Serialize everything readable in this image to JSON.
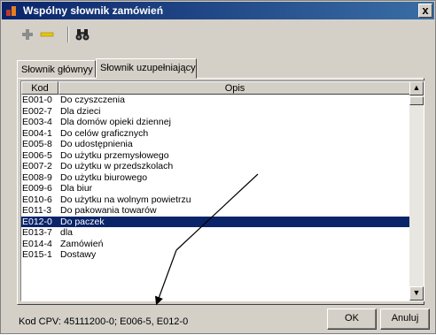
{
  "window": {
    "title": "Wspólny słownik zamówień",
    "close_label": "x"
  },
  "toolbar": {
    "add_icon": "plus-icon",
    "remove_icon": "minus-icon",
    "find_icon": "binoculars-icon"
  },
  "tabs": [
    {
      "label": "Słownik głównyy"
    },
    {
      "label": "Słownik uzupełniający"
    }
  ],
  "table": {
    "headers": {
      "kod": "Kod",
      "opis": "Opis"
    },
    "rows": [
      {
        "kod": "E001-0",
        "opis": "Do czyszczenia"
      },
      {
        "kod": "E002-7",
        "opis": "Dla dzieci"
      },
      {
        "kod": "E003-4",
        "opis": "Dla domów opieki dziennej"
      },
      {
        "kod": "E004-1",
        "opis": "Do celów graficznych"
      },
      {
        "kod": "E005-8",
        "opis": "Do udostępnienia"
      },
      {
        "kod": "E006-5",
        "opis": "Do użytku przemysłowego"
      },
      {
        "kod": "E007-2",
        "opis": "Do użytku w przedszkolach"
      },
      {
        "kod": "E008-9",
        "opis": "Do użytku biurowego"
      },
      {
        "kod": "E009-6",
        "opis": "Dla biur"
      },
      {
        "kod": "E010-6",
        "opis": "Do użytku na wolnym powietrzu"
      },
      {
        "kod": "E011-3",
        "opis": "Do pakowania towarów"
      },
      {
        "kod": "E012-0",
        "opis": "Do paczek",
        "selected": true
      },
      {
        "kod": "E013-7",
        "opis": "dla"
      },
      {
        "kod": "E014-4",
        "opis": "Zamówień"
      },
      {
        "kod": "E015-1",
        "opis": "Dostawy"
      }
    ]
  },
  "status": {
    "text": "Kod CPV: 45111200-0; E006-5, E012-0"
  },
  "buttons": {
    "ok": "OK",
    "cancel": "Anuluj"
  },
  "colors": {
    "selection": "#0a246a",
    "title_bar": "#0a246a",
    "face": "#d4d0c8"
  }
}
